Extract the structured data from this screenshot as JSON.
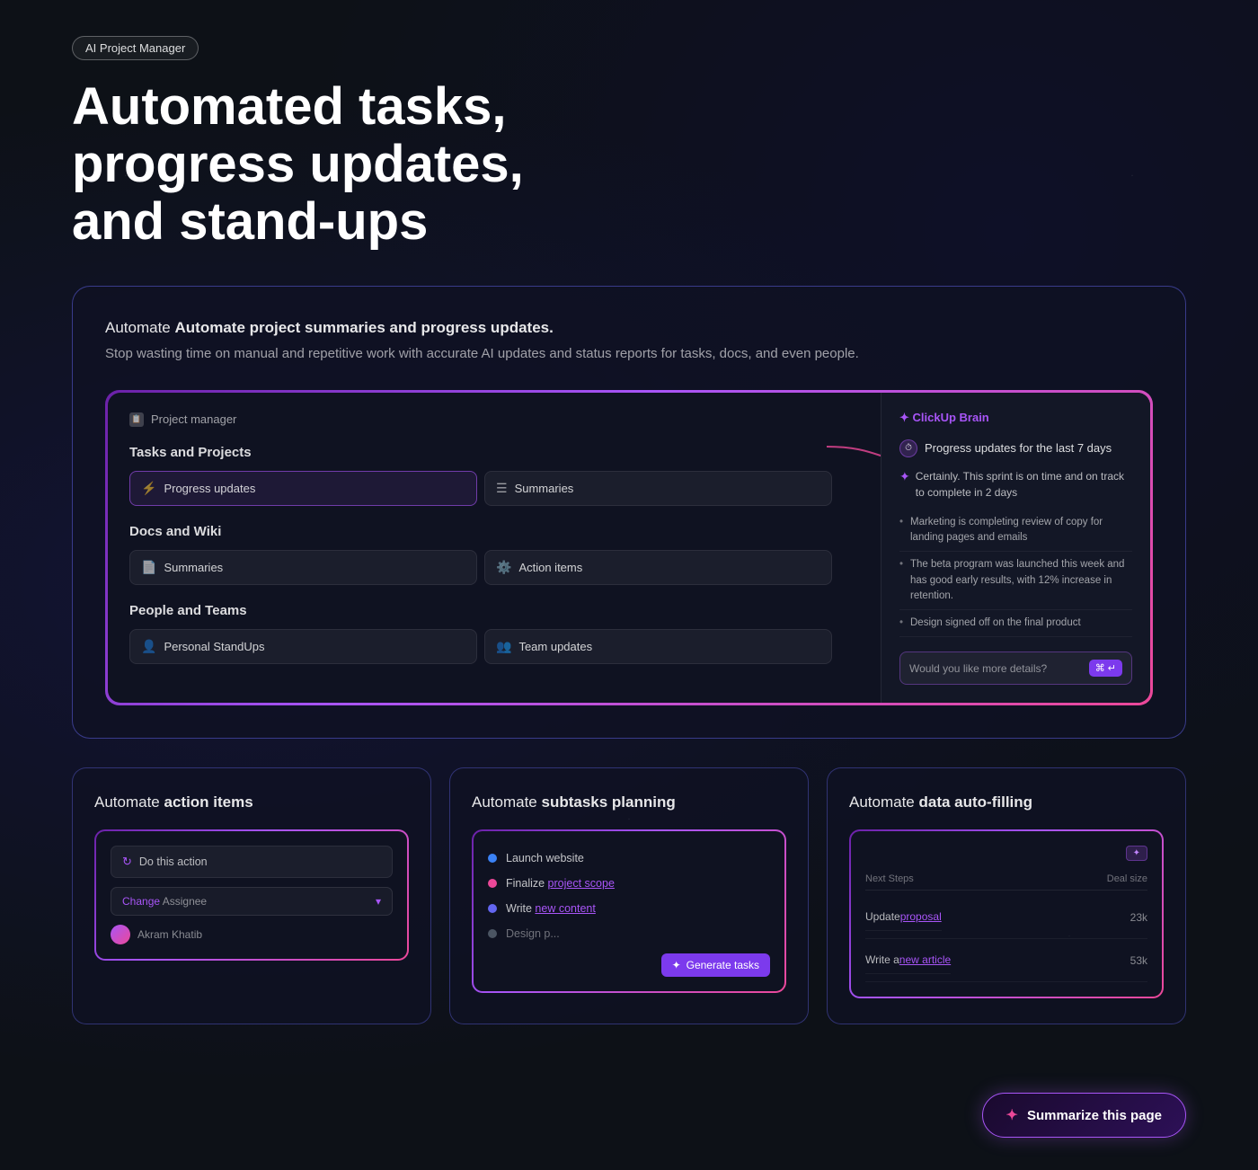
{
  "badge": {
    "label": "AI Project Manager"
  },
  "header": {
    "title": "Automated tasks, progress updates, and stand-ups"
  },
  "main_card": {
    "description_bold": "Automate project summaries and progress updates.",
    "description_normal": "Automate ",
    "sub_text": "Stop wasting time on manual and repetitive work with accurate AI updates and status reports for tasks, docs, and even people.",
    "demo": {
      "header_icon": "📋",
      "header_label": "Project manager",
      "sections": [
        {
          "title": "Tasks and Projects",
          "items": [
            {
              "icon": "⚡",
              "label": "Progress updates",
              "active": true
            },
            {
              "icon": "☰",
              "label": "Summaries",
              "active": false
            }
          ]
        },
        {
          "title": "Docs and Wiki",
          "items": [
            {
              "icon": "📄",
              "label": "Summaries",
              "active": false
            },
            {
              "icon": "⚙️",
              "label": "Action items",
              "active": false
            }
          ]
        },
        {
          "title": "People and Teams",
          "items": [
            {
              "icon": "👤",
              "label": "Personal StandUps",
              "active": false
            },
            {
              "icon": "👥",
              "label": "Team updates",
              "active": false
            }
          ]
        }
      ],
      "ai_panel": {
        "logo": "✦ ClickUp Brain",
        "query_icon": "⏱",
        "query_text": "Progress updates for the last 7 days",
        "sparkle": "✦",
        "intro": "Certainly. This sprint is on time and on track to complete in 2 days",
        "bullets": [
          "Marketing is completing review of copy for landing pages and emails",
          "The beta program was launched this week and has good early results, with 12% increase in retention.",
          "Design signed off on the final product"
        ],
        "input_placeholder": "Would you like more details?",
        "input_badge": "⌘ ↵"
      }
    }
  },
  "bottom_cards": [
    {
      "title_normal": "Automate ",
      "title_bold": "action items",
      "visual": {
        "do_action": "Do this action",
        "change_label": "Change",
        "change_value": "Assignee",
        "user_name": "Akram Khatib"
      }
    },
    {
      "title_normal": "Automate ",
      "title_bold": "subtasks planning",
      "visual": {
        "items": [
          {
            "color": "#3b82f6",
            "text": "Launch website"
          },
          {
            "color": "#ec4899",
            "text": "Finalize project scope"
          },
          {
            "color": "#6366f1",
            "text": "Write new content"
          },
          {
            "color": "#6b7280",
            "text": "Design p..."
          }
        ],
        "button": "Generate tasks"
      }
    },
    {
      "title_normal": "Automate ",
      "title_bold": "data auto-filling",
      "visual": {
        "ai_icon": "✦",
        "columns": [
          "Next Steps",
          "Deal size"
        ],
        "rows": [
          {
            "step": "Update proposal",
            "step_highlight": "proposal",
            "value": "23k"
          },
          {
            "step": "Write a new article",
            "step_highlight": "new article",
            "value": "53k"
          }
        ]
      }
    }
  ],
  "summarize_button": {
    "icon": "✦",
    "label": "Summarize this page"
  }
}
